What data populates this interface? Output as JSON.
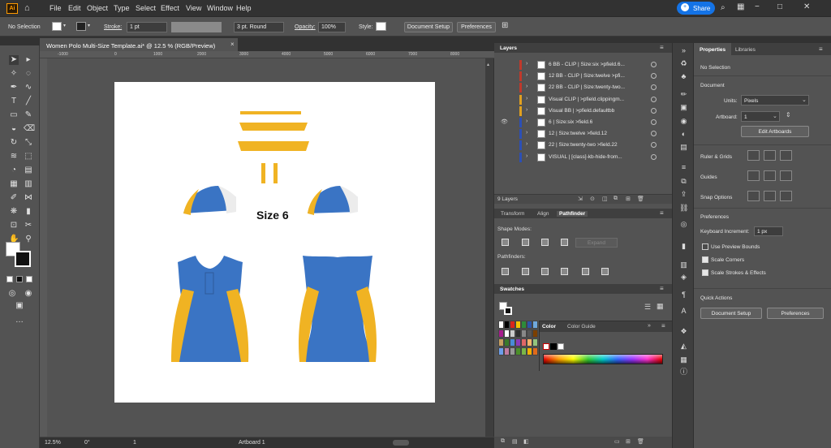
{
  "menubar": {
    "items": [
      "File",
      "Edit",
      "Object",
      "Type",
      "Select",
      "Effect",
      "View",
      "Window",
      "Help"
    ],
    "share_label": "Share"
  },
  "control": {
    "selection": "No Selection",
    "stroke_label": "Stroke:",
    "stroke_value": "1 pt",
    "brush_value": "3 pt. Round",
    "opacity_label": "Opacity:",
    "opacity_value": "100%",
    "style_label": "Style:",
    "doc_setup": "Document Setup",
    "preferences": "Preferences"
  },
  "document": {
    "tab_title": "Women Polo Multi-Size Template.ai* @ 12.5 % (RGB/Preview)",
    "size_label": "Size 6"
  },
  "ruler": {
    "ticks": [
      "-1000",
      "0",
      "1000",
      "2000",
      "3000",
      "4000",
      "5000",
      "6000",
      "7000",
      "8000"
    ]
  },
  "status": {
    "zoom": "12.5%",
    "rotation": "0°",
    "artboard_num": "1",
    "artboard_label": "Artboard 1"
  },
  "layers": {
    "tab": "Layers",
    "rows": [
      {
        "name": "6 BB - CLIP | Size:six >pfield.6...",
        "color": "#c0392b",
        "visible": false
      },
      {
        "name": "12 BB - CLIP | Size:twelve >pfi...",
        "color": "#c0392b",
        "visible": false
      },
      {
        "name": "22 BB - CLIP | Size:twenty-two...",
        "color": "#c0392b",
        "visible": false
      },
      {
        "name": "Visual CLIP | >pfield.clippingm...",
        "color": "#e0a020",
        "visible": false
      },
      {
        "name": "Visual BB | >pfield.defaultbb",
        "color": "#e0a020",
        "visible": false
      },
      {
        "name": "6 | Size:six >field.6",
        "color": "#2c4fb5",
        "visible": true
      },
      {
        "name": "12 | Size:twelve >field.12",
        "color": "#2c4fb5",
        "visible": false
      },
      {
        "name": "22 | Size:twenty-two >field.22",
        "color": "#2c4fb5",
        "visible": false
      },
      {
        "name": "VISUAL | [class]-kb-hide-from...",
        "color": "#2c4fb5",
        "visible": false
      }
    ],
    "count": "9 Layers"
  },
  "transform_tabs": [
    "Transform",
    "Align",
    "Pathfinder"
  ],
  "pathfinder": {
    "shape_modes": "Shape Modes:",
    "expand": "Expand",
    "pathfinders": "Pathfinders:"
  },
  "swatches": {
    "tab": "Swatches",
    "colors": [
      "#ffffff",
      "#000000",
      "#d9261c",
      "#f4c400",
      "#2e8b3a",
      "#2d55a8",
      "#6fa8dc",
      "#a61c8c",
      "#ffffff",
      "#cccccc",
      "#2e2e2e",
      "#888888",
      "#555555",
      "#7b3f00",
      "#c8a060",
      "#3a7a2a",
      "#4a8bd6",
      "#8a3ab9",
      "#e06666",
      "#f6b26b",
      "#93c47d",
      "#6d9eeb",
      "#c27ba0",
      "#999999",
      "#4b8f29",
      "#7ab648",
      "#f0b000",
      "#e06a1b"
    ]
  },
  "color": {
    "tabs": [
      "Color",
      "Color Guide"
    ]
  },
  "properties": {
    "tabs": [
      "Properties",
      "Libraries"
    ],
    "selection": "No Selection",
    "document_label": "Document",
    "units_label": "Units:",
    "units_value": "Pixels",
    "artboard_label": "Artboard:",
    "artboard_value": "1",
    "edit_artboards": "Edit Artboards",
    "ruler_grids": "Ruler & Grids",
    "guides": "Guides",
    "snap_options": "Snap Options",
    "preferences_label": "Preferences",
    "keyboard_increment_label": "Keyboard Increment:",
    "keyboard_increment_value": "1 px",
    "use_preview_bounds": "Use Preview Bounds",
    "scale_corners": "Scale Corners",
    "scale_strokes": "Scale Strokes & Effects",
    "quick_actions": "Quick Actions",
    "document_setup": "Document Setup",
    "preferences_btn": "Preferences"
  },
  "colors": {
    "accent": "#1473e6",
    "shirt_blue": "#3a74c4",
    "shirt_gold": "#f0b323",
    "panel_bg": "#535353",
    "app_bg": "#323232"
  }
}
